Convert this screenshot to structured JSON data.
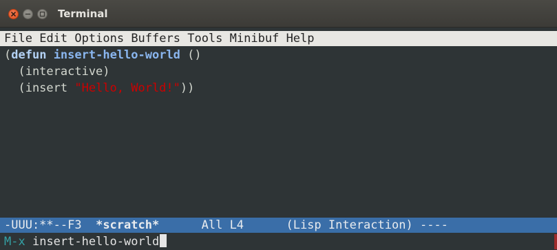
{
  "window": {
    "title": "Terminal"
  },
  "menu": {
    "items": [
      "File",
      "Edit",
      "Options",
      "Buffers",
      "Tools",
      "Minibuf",
      "Help"
    ]
  },
  "code": {
    "line1": {
      "open": "(",
      "keyword": "defun",
      "name": "insert-hello-world",
      "rest": " ()"
    },
    "line2": "  (interactive)",
    "line3": {
      "prefix": "  (insert ",
      "string": "\"Hello, World!\"",
      "suffix": "))"
    }
  },
  "modeline": {
    "status": "-UUU:**--F3",
    "buffer_name": "*scratch*",
    "position": "All L4",
    "mode": "(Lisp Interaction)",
    "trail": "----"
  },
  "minibuffer": {
    "prompt": "M-x",
    "input": "insert-hello-world"
  },
  "colors": {
    "background": "#2e3436",
    "menubar": "#e8e7e3",
    "modeline": "#3a6ea8",
    "string": "#cc0000",
    "keyword": "#b4d2f5",
    "prompt": "#34a1a5",
    "close_button": "#df4a16"
  },
  "icons": {
    "close": "close-icon",
    "minimize": "minimize-icon",
    "maximize": "maximize-icon"
  }
}
